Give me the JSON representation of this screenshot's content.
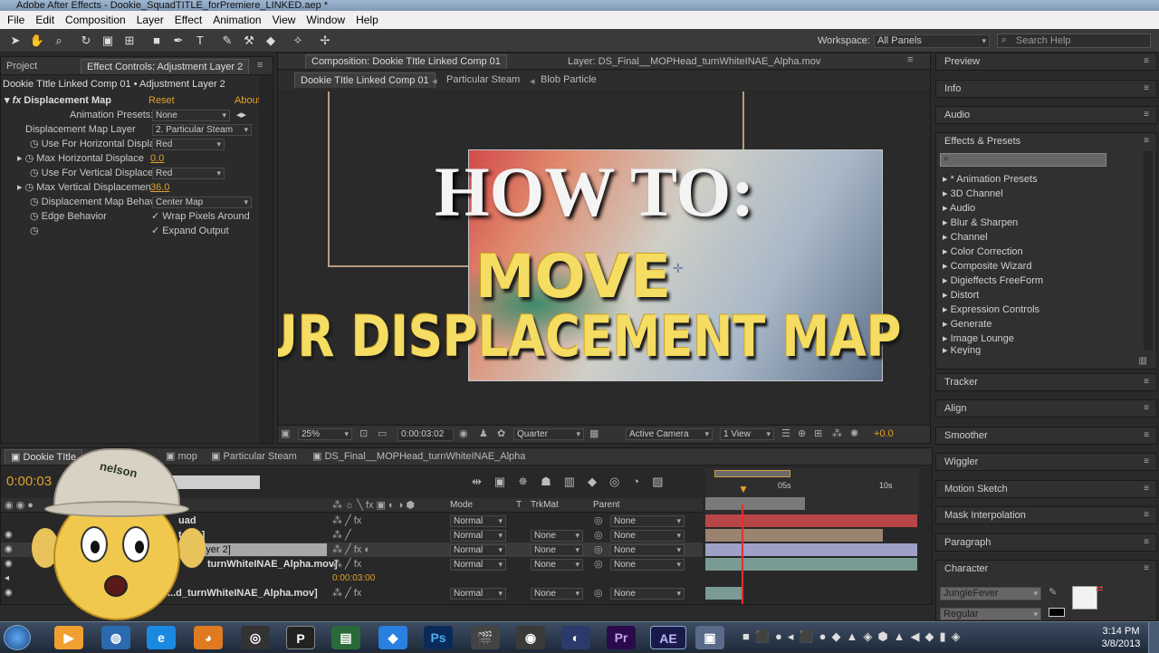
{
  "window": {
    "title": "Adobe After Effects - Dookie_SquadTITLE_forPremiere_LINKED.aep *"
  },
  "menu": [
    "File",
    "Edit",
    "Composition",
    "Layer",
    "Effect",
    "Animation",
    "View",
    "Window",
    "Help"
  ],
  "toolbar": {
    "workspace_label": "Workspace:",
    "workspace_value": "All Panels",
    "search_placeholder": "Search Help"
  },
  "project_panel": {
    "tab_project": "Project",
    "tab_effect_controls": "Effect Controls: Adjustment Layer 2",
    "breadcrumb": "Dookie TItle Linked Comp 01 • Adjustment Layer 2",
    "effect": {
      "name": "Displacement Map",
      "reset": "Reset",
      "about": "About"
    },
    "properties": [
      {
        "label": "Animation Presets:",
        "value": "None",
        "type": "dropdown"
      },
      {
        "label": "Displacement Map Layer",
        "value": "2. Particular Steam",
        "type": "dropdown"
      },
      {
        "label": "Use For Horizontal Displa",
        "value": "Red",
        "type": "dropdown"
      },
      {
        "label": "Max Horizontal Displace",
        "value": "0.0",
        "type": "number"
      },
      {
        "label": "Use For Vertical Displace",
        "value": "Red",
        "type": "dropdown"
      },
      {
        "label": "Max Vertical Displacemen",
        "value": "36.0",
        "type": "number"
      },
      {
        "label": "Displacement Map Behav",
        "value": "Center Map",
        "type": "dropdown"
      },
      {
        "label": "Edge Behavior",
        "value": "Wrap Pixels Around",
        "type": "checkbox"
      },
      {
        "label": "",
        "value": "Expand Output",
        "type": "checkbox"
      }
    ]
  },
  "composition": {
    "tab_comp": "Composition: Dookie TItle Linked Comp 01",
    "tab_layer": "Layer: DS_Final__MOPHead_turnWhiteINAE_Alpha.mov",
    "flow": [
      "Dookie TItle Linked Comp 01",
      "Particular Steam",
      "Blob Particle"
    ],
    "overlay_line1": "HOW TO:",
    "overlay_line2": "MOVE",
    "overlay_line3": "YOUR DISPLACEMENT MAP",
    "footer": {
      "zoom": "25%",
      "timecode": "0:00:03:02",
      "resolution": "Quarter",
      "camera": "Active Camera",
      "views": "1 View",
      "exposure": "+0.0"
    }
  },
  "right_panels": {
    "preview": "Preview",
    "info": "Info",
    "audio": "Audio",
    "effects_presets": "Effects & Presets",
    "effects_list": [
      "* Animation Presets",
      "3D Channel",
      "Audio",
      "Blur & Sharpen",
      "Channel",
      "Color Correction",
      "Composite Wizard",
      "Digieffects FreeForm",
      "Distort",
      "Expression Controls",
      "Generate",
      "Image Lounge",
      "Keying"
    ],
    "others": [
      "Tracker",
      "Align",
      "Smoother",
      "Wiggler",
      "Motion Sketch",
      "Mask Interpolation",
      "Paragraph",
      "Character"
    ],
    "character_font": "JungleFever",
    "character_style": "Regular"
  },
  "timeline": {
    "tabs": [
      "Dookie TItle",
      "mop",
      "Particular Steam",
      "DS_Final__MOPHead_turnWhiteINAE_Alpha"
    ],
    "timecode": "0:00:03",
    "headers": {
      "mode": "Mode",
      "t": "T",
      "trkmat": "TrkMat",
      "parent": "Parent"
    },
    "ruler": [
      "05s",
      "10s"
    ],
    "layers": [
      {
        "name": "uad",
        "mode": "Normal",
        "trkmat": "",
        "parent": "None"
      },
      {
        "name": "team]",
        "mode": "Normal",
        "trkmat": "None",
        "parent": "None"
      },
      {
        "name": "Layer 2]",
        "mode": "Normal",
        "trkmat": "None",
        "parent": "None"
      },
      {
        "name": "turnWhiteINAE_Alpha.mov]",
        "mode": "Normal",
        "trkmat": "None",
        "parent": "None"
      },
      {
        "name": "...d_turnWhiteINAE_Alpha.mov]",
        "mode": "Normal",
        "trkmat": "None",
        "parent": "None"
      }
    ],
    "sub_timecode": "0:00:03:00",
    "cap_text": "nelson"
  },
  "taskbar": {
    "time": "3:14 PM",
    "date": "3/8/2013"
  }
}
